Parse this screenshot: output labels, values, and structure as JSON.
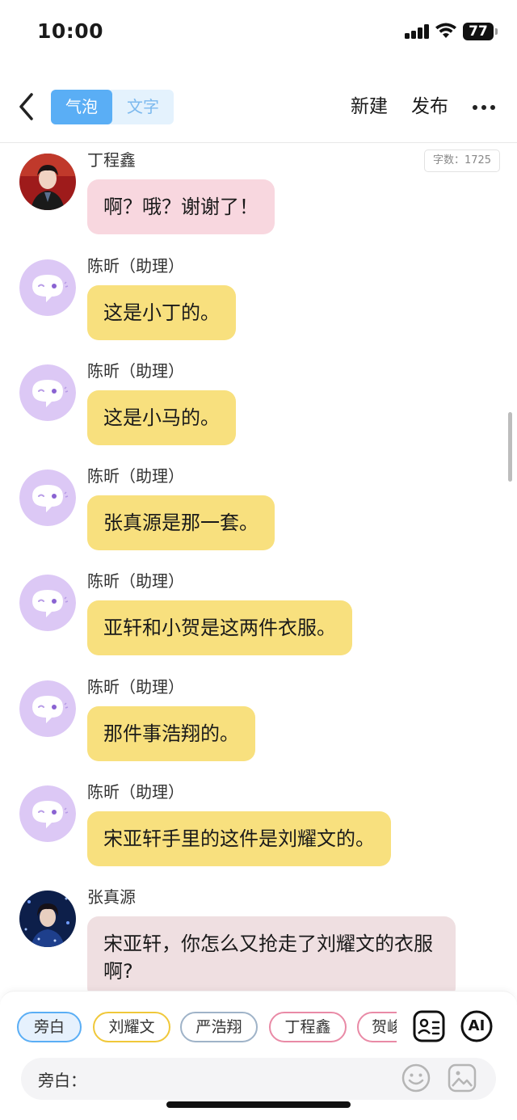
{
  "status_bar": {
    "time": "10:00",
    "battery": "77"
  },
  "nav": {
    "seg_bubble": "气泡",
    "seg_text": "文字",
    "new_label": "新建",
    "publish_label": "发布"
  },
  "chat": {
    "word_count": "字数：1725",
    "messages": [
      {
        "name": "丁程鑫",
        "text": "啊？哦？谢谢了！"
      },
      {
        "name": "陈昕（助理）",
        "text": "这是小丁的。"
      },
      {
        "name": "陈昕（助理）",
        "text": "这是小马的。"
      },
      {
        "name": "陈昕（助理）",
        "text": "张真源是那一套。"
      },
      {
        "name": "陈昕（助理）",
        "text": "亚轩和小贺是这两件衣服。"
      },
      {
        "name": "陈昕（助理）",
        "text": "那件事浩翔的。"
      },
      {
        "name": "陈昕（助理）",
        "text": "宋亚轩手里的这件是刘耀文的。"
      },
      {
        "name": "张真源",
        "text": "宋亚轩，你怎么又抢走了刘耀文的衣服啊?"
      }
    ]
  },
  "bottom": {
    "chips": [
      "旁白",
      "刘耀文",
      "严浩翔",
      "丁程鑫",
      "贺峻"
    ],
    "chip_colors": [
      "#5aaef5",
      "#f0c83a",
      "#9fb3c8",
      "#e98aa6",
      "#e98aa6"
    ],
    "ai_label": "AI",
    "input_label": "旁白："
  },
  "colors": {
    "accent": "#5aaef5",
    "bubble_pink": "#f8d7df",
    "bubble_yellow": "#f8e07e",
    "bubble_rose": "#efdfe1",
    "assistant_avatar": "#dcc8f5"
  }
}
